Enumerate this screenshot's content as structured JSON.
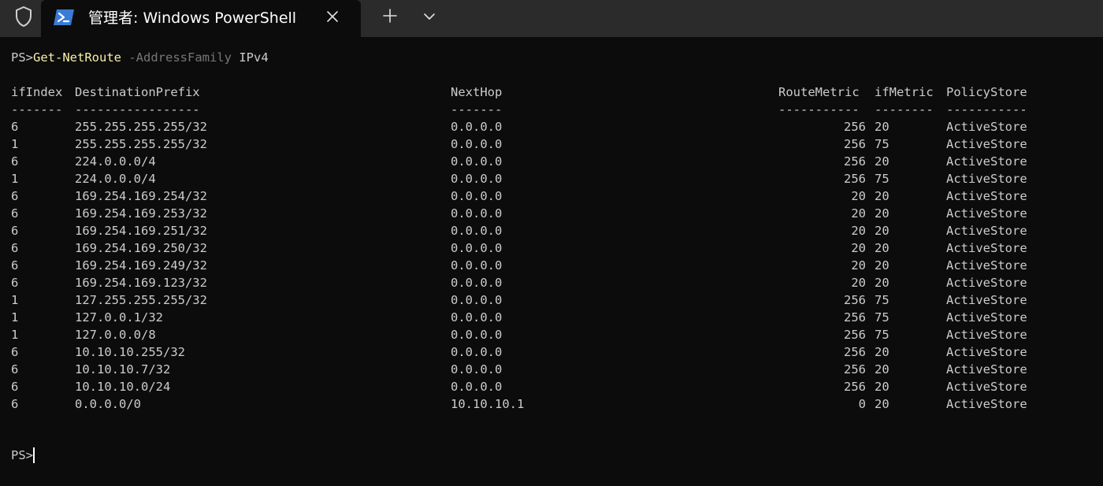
{
  "tab": {
    "title": "管理者: Windows PowerShell"
  },
  "icons": {
    "shield": "shield-icon",
    "powershell": "powershell-icon",
    "close": "close-icon",
    "new_tab": "plus-icon",
    "dropdown": "chevron-down-icon"
  },
  "colors": {
    "background": "#0c0c0c",
    "tabbar": "#2b2b2b",
    "text": "#cccccc",
    "command": "#f9f1a5",
    "parameter": "#767676",
    "powershell_blue": "#3a7bd5"
  },
  "command_line": {
    "prompt": "PS>",
    "command": "Get-NetRoute",
    "parameter": "-AddressFamily",
    "argument": "IPv4"
  },
  "table": {
    "headers": {
      "ifIndex": "ifIndex",
      "destination": "DestinationPrefix",
      "nexthop": "NextHop",
      "routemetric": "RouteMetric",
      "ifmetric": "ifMetric",
      "policystore": "PolicyStore"
    },
    "separators": {
      "ifIndex": "-------",
      "destination": "-----------------",
      "nexthop": "-------",
      "routemetric": "-----------",
      "ifmetric": "--------",
      "policystore": "-----------"
    },
    "rows": [
      {
        "ifIndex": "6",
        "destination": "255.255.255.255/32",
        "nexthop": "0.0.0.0",
        "routemetric": "256",
        "ifmetric": "20",
        "policystore": "ActiveStore"
      },
      {
        "ifIndex": "1",
        "destination": "255.255.255.255/32",
        "nexthop": "0.0.0.0",
        "routemetric": "256",
        "ifmetric": "75",
        "policystore": "ActiveStore"
      },
      {
        "ifIndex": "6",
        "destination": "224.0.0.0/4",
        "nexthop": "0.0.0.0",
        "routemetric": "256",
        "ifmetric": "20",
        "policystore": "ActiveStore"
      },
      {
        "ifIndex": "1",
        "destination": "224.0.0.0/4",
        "nexthop": "0.0.0.0",
        "routemetric": "256",
        "ifmetric": "75",
        "policystore": "ActiveStore"
      },
      {
        "ifIndex": "6",
        "destination": "169.254.169.254/32",
        "nexthop": "0.0.0.0",
        "routemetric": "20",
        "ifmetric": "20",
        "policystore": "ActiveStore"
      },
      {
        "ifIndex": "6",
        "destination": "169.254.169.253/32",
        "nexthop": "0.0.0.0",
        "routemetric": "20",
        "ifmetric": "20",
        "policystore": "ActiveStore"
      },
      {
        "ifIndex": "6",
        "destination": "169.254.169.251/32",
        "nexthop": "0.0.0.0",
        "routemetric": "20",
        "ifmetric": "20",
        "policystore": "ActiveStore"
      },
      {
        "ifIndex": "6",
        "destination": "169.254.169.250/32",
        "nexthop": "0.0.0.0",
        "routemetric": "20",
        "ifmetric": "20",
        "policystore": "ActiveStore"
      },
      {
        "ifIndex": "6",
        "destination": "169.254.169.249/32",
        "nexthop": "0.0.0.0",
        "routemetric": "20",
        "ifmetric": "20",
        "policystore": "ActiveStore"
      },
      {
        "ifIndex": "6",
        "destination": "169.254.169.123/32",
        "nexthop": "0.0.0.0",
        "routemetric": "20",
        "ifmetric": "20",
        "policystore": "ActiveStore"
      },
      {
        "ifIndex": "1",
        "destination": "127.255.255.255/32",
        "nexthop": "0.0.0.0",
        "routemetric": "256",
        "ifmetric": "75",
        "policystore": "ActiveStore"
      },
      {
        "ifIndex": "1",
        "destination": "127.0.0.1/32",
        "nexthop": "0.0.0.0",
        "routemetric": "256",
        "ifmetric": "75",
        "policystore": "ActiveStore"
      },
      {
        "ifIndex": "1",
        "destination": "127.0.0.0/8",
        "nexthop": "0.0.0.0",
        "routemetric": "256",
        "ifmetric": "75",
        "policystore": "ActiveStore"
      },
      {
        "ifIndex": "6",
        "destination": "10.10.10.255/32",
        "nexthop": "0.0.0.0",
        "routemetric": "256",
        "ifmetric": "20",
        "policystore": "ActiveStore"
      },
      {
        "ifIndex": "6",
        "destination": "10.10.10.7/32",
        "nexthop": "0.0.0.0",
        "routemetric": "256",
        "ifmetric": "20",
        "policystore": "ActiveStore"
      },
      {
        "ifIndex": "6",
        "destination": "10.10.10.0/24",
        "nexthop": "0.0.0.0",
        "routemetric": "256",
        "ifmetric": "20",
        "policystore": "ActiveStore"
      },
      {
        "ifIndex": "6",
        "destination": "0.0.0.0/0",
        "nexthop": "10.10.10.1",
        "routemetric": "0",
        "ifmetric": "20",
        "policystore": "ActiveStore"
      }
    ]
  },
  "final_prompt": "PS>"
}
